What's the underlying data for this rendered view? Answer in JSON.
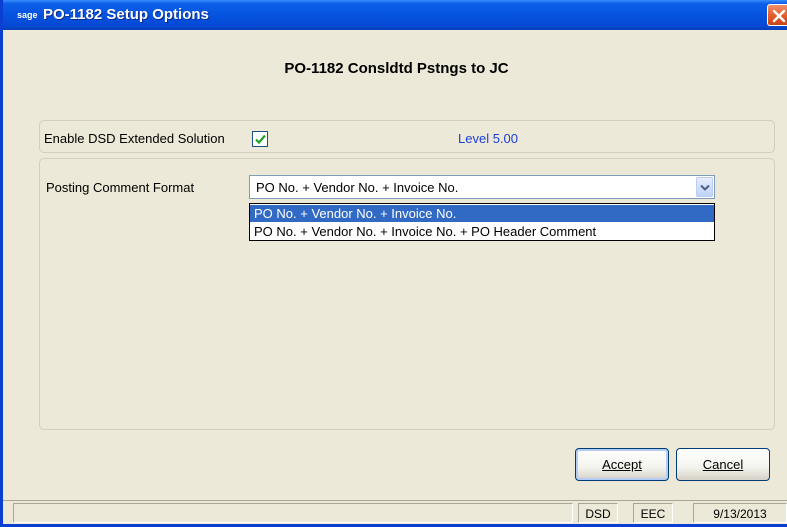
{
  "window": {
    "app_logo": "sage",
    "title": "PO-1182 Setup Options",
    "close_icon": "close-icon"
  },
  "heading": "PO-1182 Consldtd Pstngs to JC",
  "enable": {
    "label": "Enable DSD Extended Solution",
    "checked": true,
    "level": "Level  5.00"
  },
  "posting": {
    "label": "Posting Comment Format",
    "selected": "PO No. + Vendor No. + Invoice No.",
    "options": [
      "PO No. + Vendor No. + Invoice No.",
      "PO No. + Vendor No. + Invoice No. + PO Header Comment"
    ]
  },
  "buttons": {
    "accept": "Accept",
    "cancel": "Cancel"
  },
  "statusbar": {
    "main": "",
    "company": "DSD",
    "code": "EEC",
    "date": "9/13/2013"
  },
  "colors": {
    "titlebar": "#0553e0",
    "selection": "#316ac5",
    "level_text": "#1b3fd8"
  }
}
